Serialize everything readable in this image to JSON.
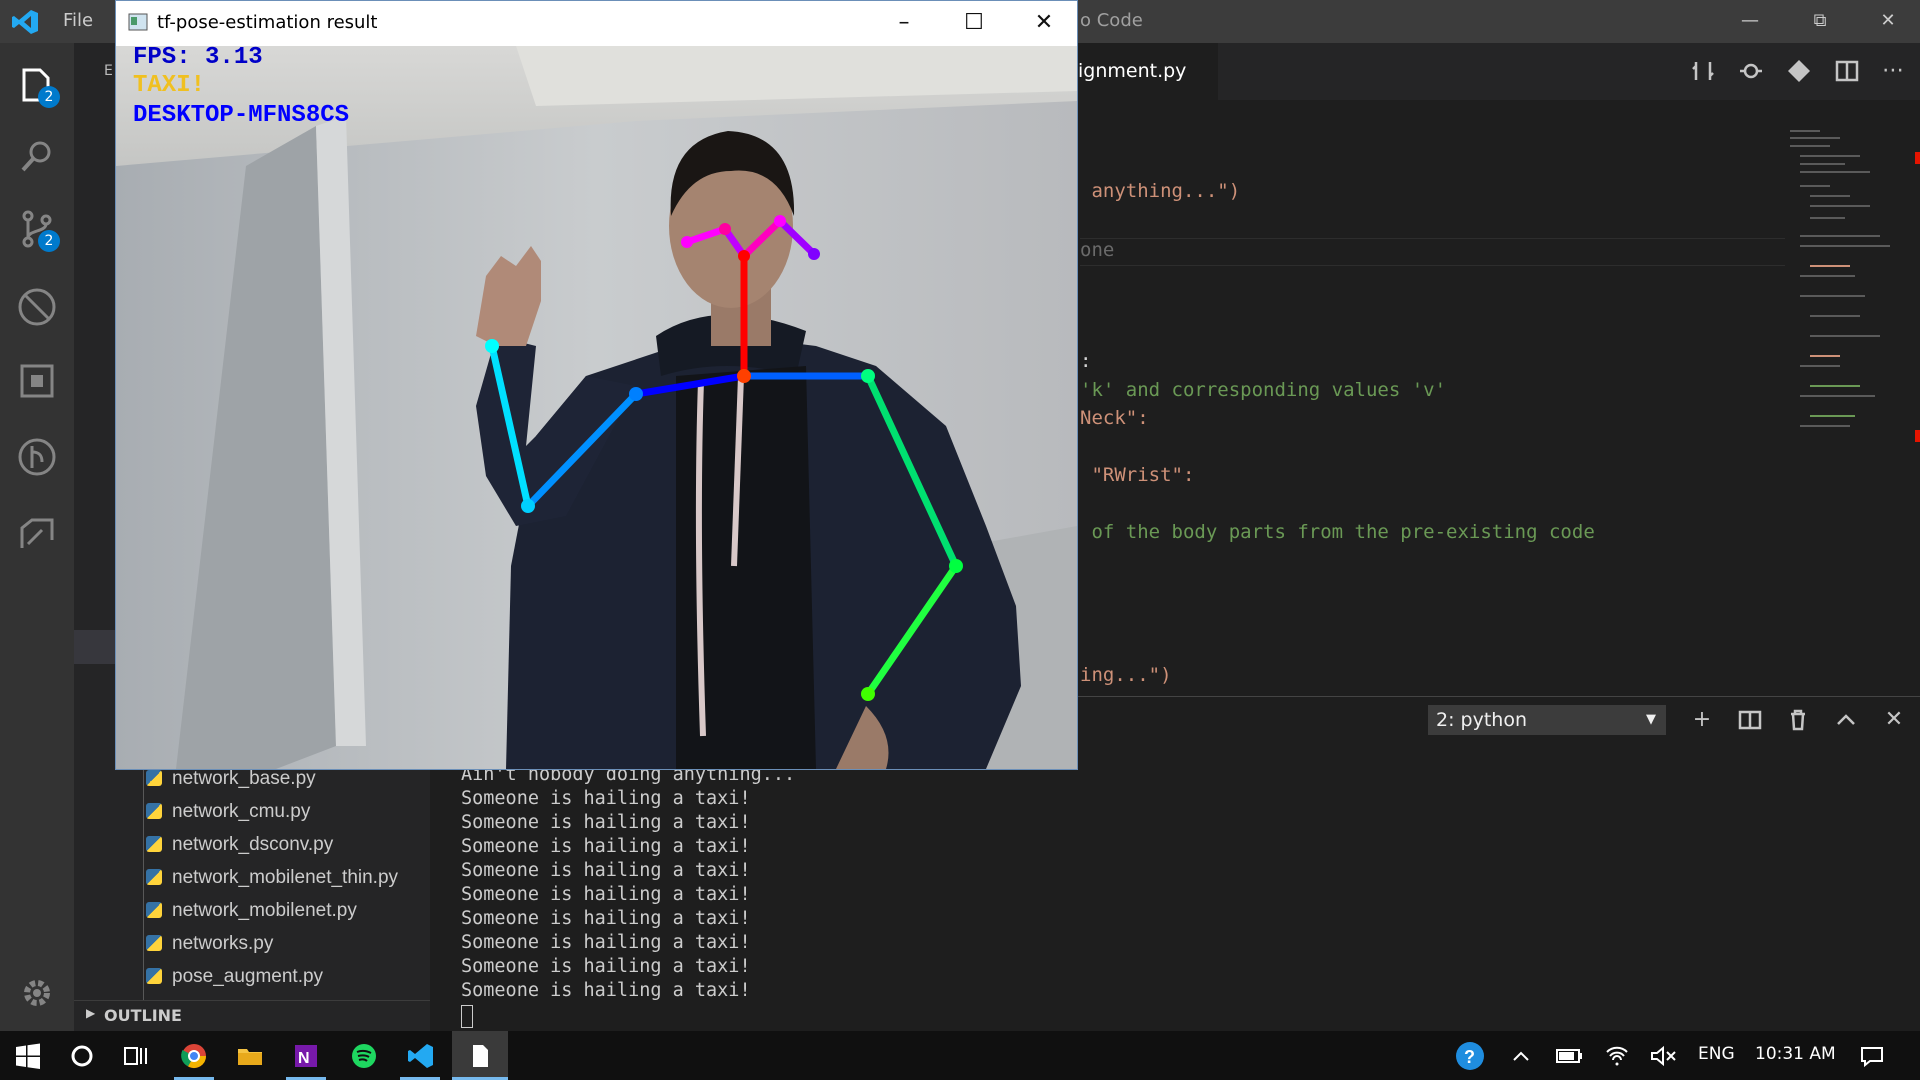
{
  "vscode": {
    "menu": {
      "file": "File"
    },
    "title_partial": "o Code",
    "activity_badges": {
      "explorer": "2",
      "scm": "2"
    },
    "sidebar": {
      "header": "E",
      "files": [
        "network_base.py",
        "network_cmu.py",
        "network_dsconv.py",
        "network_mobilenet_thin.py",
        "network_mobilenet.py",
        "networks.py",
        "pose_augment.py"
      ],
      "outline_label": "OUTLINE"
    },
    "editor": {
      "active_tab": "ignment.py",
      "code_lines": [
        {
          "text": " anything...\")",
          "kind": "str"
        },
        {
          "text": "one",
          "kind": "dim"
        },
        {
          "text": ":",
          "kind": "plain"
        },
        {
          "text": "'k' and corresponding values 'v'",
          "kind": "cmt"
        },
        {
          "text": "Neck\":",
          "kind": "str"
        },
        {
          "text": " \"RWrist\":",
          "kind": "str"
        },
        {
          "text": " of the body parts from the pre-existing code",
          "kind": "cmt"
        },
        {
          "text": "ing...\")",
          "kind": "str"
        }
      ]
    },
    "panel": {
      "terminal_select": "2: python",
      "lines": [
        "Ain't nobody doing anything...",
        "Someone is hailing a taxi!",
        "Someone is hailing a taxi!",
        "Someone is hailing a taxi!",
        "Someone is hailing a taxi!",
        "Someone is hailing a taxi!",
        "Someone is hailing a taxi!",
        "Someone is hailing a taxi!",
        "Someone is hailing a taxi!",
        "Someone is hailing a taxi!"
      ]
    }
  },
  "pose_window": {
    "title": "tf-pose-estimation result",
    "overlay": {
      "fps": "FPS: 3.13",
      "status": "TAXI!",
      "host": "DESKTOP-MFNS8CS"
    }
  },
  "taskbar": {
    "lang": "ENG",
    "time": "10:31 AM"
  },
  "colors": {
    "accent": "#007acc",
    "fps_text": "#0000c8",
    "status_text": "#f0c020",
    "host_text": "#0000ff"
  }
}
